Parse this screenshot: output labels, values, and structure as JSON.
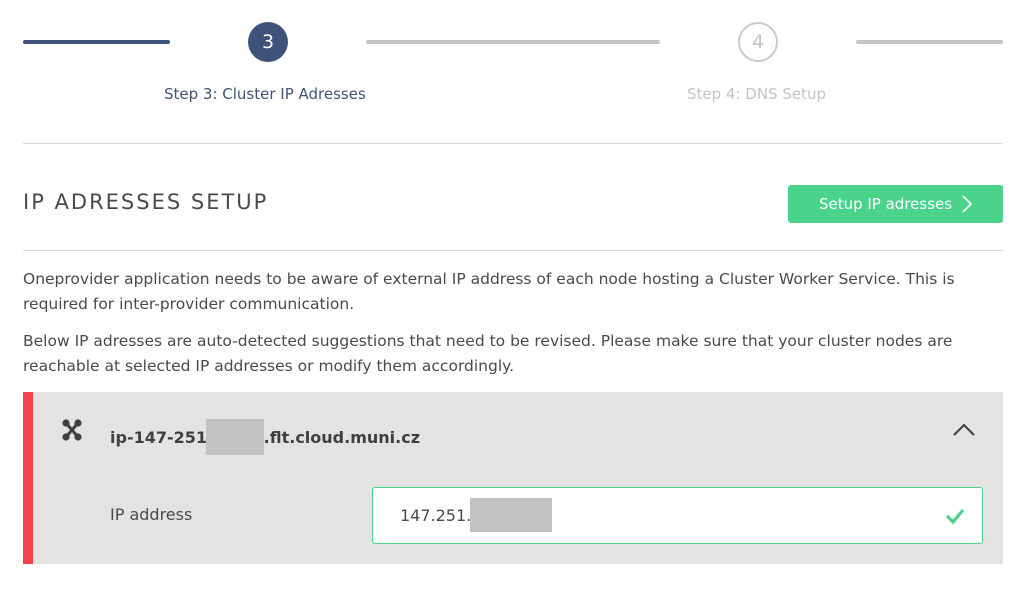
{
  "stepper": {
    "steps": [
      {
        "number": "3",
        "label": "Step 3: Cluster IP Adresses",
        "state": "active"
      },
      {
        "number": "4",
        "label": "Step 4: DNS Setup",
        "state": "inactive"
      }
    ]
  },
  "section": {
    "title": "IP ADRESSES SETUP",
    "setup_button_label": "Setup IP adresses"
  },
  "description": {
    "paragraph1": "Oneprovider application needs to be aware of external IP address of each node hosting a Cluster Worker Service. This is required for inter-provider communication.",
    "paragraph2": "Below IP adresses are auto-detected suggestions that need to be revised. Please make sure that your cluster nodes are reachable at selected IP addresses or modify them accordingly."
  },
  "node": {
    "hostname_prefix": "ip-147-251-",
    "hostname_suffix": ".flt.cloud.muni.cz",
    "ip_label": "IP address",
    "ip_value_prefix": "147.251.",
    "status": "valid"
  },
  "colors": {
    "primary": "#3f537a",
    "success": "#4bd28b",
    "error_accent": "#f0434a",
    "inactive": "#c4c4c4",
    "panel_bg": "#e5e3e2"
  }
}
